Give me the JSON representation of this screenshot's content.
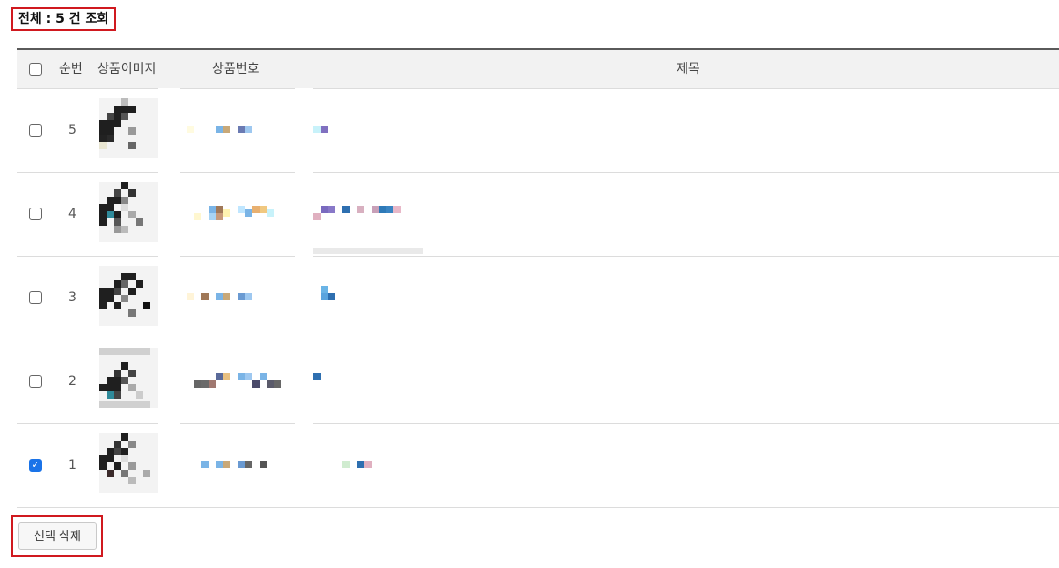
{
  "summary": "전체 : 5 건 조회",
  "table": {
    "headers": {
      "num": "순번",
      "image": "상품이미지",
      "code": "상품번호",
      "title": "제목"
    },
    "rows": [
      {
        "num": "5",
        "checked": false
      },
      {
        "num": "4",
        "checked": false
      },
      {
        "num": "3",
        "checked": false
      },
      {
        "num": "2",
        "checked": false
      },
      {
        "num": "1",
        "checked": true
      }
    ]
  },
  "actions": {
    "delete_selected": "선택 삭제"
  }
}
